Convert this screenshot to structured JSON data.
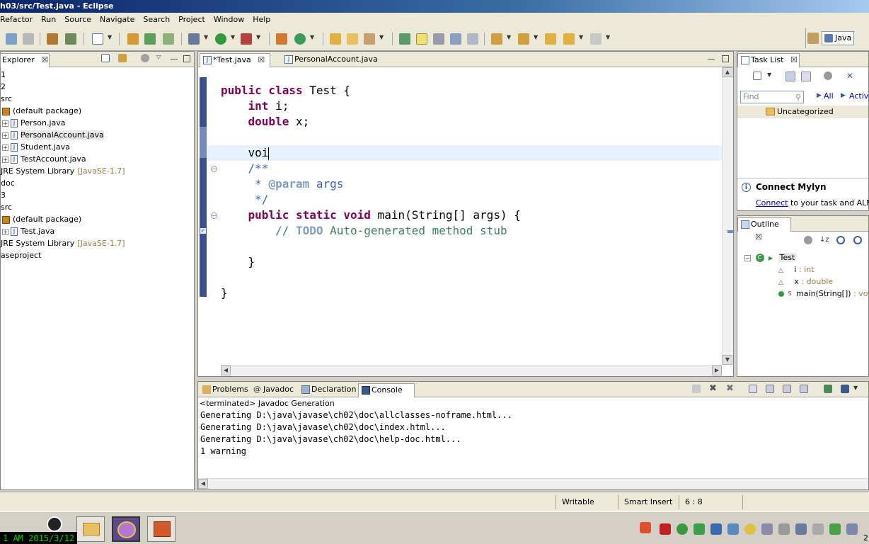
{
  "window": {
    "title": "h03/src/Test.java - Eclipse"
  },
  "menu": [
    "Refactor",
    "Run",
    "Source",
    "Navigate",
    "Search",
    "Project",
    "Window",
    "Help"
  ],
  "perspective": {
    "label": "Java"
  },
  "explorer": {
    "tab_label": "Explorer",
    "items": [
      {
        "text": "1",
        "indent": 0,
        "kind": "plain"
      },
      {
        "text": "2",
        "indent": 0,
        "kind": "plain"
      },
      {
        "text": "src",
        "indent": 0,
        "kind": "plain"
      },
      {
        "text": "(default package)",
        "indent": 1,
        "kind": "package"
      },
      {
        "text": "Person.java",
        "indent": 2,
        "kind": "java"
      },
      {
        "text": "PersonalAccount.java",
        "indent": 2,
        "kind": "java",
        "selected": true
      },
      {
        "text": "Student.java",
        "indent": 2,
        "kind": "java"
      },
      {
        "text": "TestAccount.java",
        "indent": 2,
        "kind": "java"
      },
      {
        "text": "JRE System Library",
        "suffix": "[JavaSE-1.7]",
        "indent": 0,
        "kind": "lib"
      },
      {
        "text": "doc",
        "indent": 0,
        "kind": "plain"
      },
      {
        "text": "3",
        "indent": 0,
        "kind": "plain"
      },
      {
        "text": "src",
        "indent": 0,
        "kind": "plain"
      },
      {
        "text": "(default package)",
        "indent": 1,
        "kind": "package"
      },
      {
        "text": "Test.java",
        "indent": 2,
        "kind": "java"
      },
      {
        "text": "JRE System Library",
        "suffix": "[JavaSE-1.7]",
        "indent": 0,
        "kind": "lib"
      },
      {
        "text": "aseproject",
        "indent": 0,
        "kind": "plain"
      }
    ]
  },
  "editor": {
    "tabs": [
      {
        "label": "*Test.java",
        "active": true
      },
      {
        "label": "PersonalAccount.java",
        "active": false
      }
    ],
    "lines": [
      {
        "indent": "",
        "tokens": [
          {
            "t": "public class",
            "c": "kw"
          },
          {
            "t": " Test {",
            "c": ""
          }
        ]
      },
      {
        "indent": "    ",
        "tokens": [
          {
            "t": "int",
            "c": "kw"
          },
          {
            "t": " i;",
            "c": ""
          }
        ]
      },
      {
        "indent": "    ",
        "tokens": [
          {
            "t": "double",
            "c": "kw"
          },
          {
            "t": " x;",
            "c": ""
          }
        ]
      },
      {
        "indent": "",
        "tokens": []
      },
      {
        "indent": "    ",
        "tokens": [
          {
            "t": "voi",
            "c": ""
          }
        ],
        "current": true,
        "caret": true
      },
      {
        "indent": "    ",
        "tokens": [
          {
            "t": "/**",
            "c": "cmt"
          }
        ]
      },
      {
        "indent": "     ",
        "tokens": [
          {
            "t": "* ",
            "c": "cmt"
          },
          {
            "t": "@param",
            "c": "tag"
          },
          {
            "t": " args",
            "c": "cmt"
          }
        ]
      },
      {
        "indent": "     ",
        "tokens": [
          {
            "t": "*/",
            "c": "cmt"
          }
        ]
      },
      {
        "indent": "    ",
        "tokens": [
          {
            "t": "public static void",
            "c": "kw"
          },
          {
            "t": " main(String[] args) {",
            "c": ""
          }
        ]
      },
      {
        "indent": "        ",
        "tokens": [
          {
            "t": "// ",
            "c": "lcmt"
          },
          {
            "t": "TODO",
            "c": "todo"
          },
          {
            "t": " Auto-generated method stub",
            "c": "lcmt"
          }
        ]
      },
      {
        "indent": "",
        "tokens": []
      },
      {
        "indent": "    ",
        "tokens": [
          {
            "t": "}",
            "c": ""
          }
        ]
      },
      {
        "indent": "",
        "tokens": []
      },
      {
        "indent": "",
        "tokens": [
          {
            "t": "}",
            "c": ""
          }
        ]
      }
    ]
  },
  "bottom": {
    "tabs": [
      {
        "label": "Problems",
        "active": false
      },
      {
        "label": "Javadoc",
        "active": false
      },
      {
        "label": "Declaration",
        "active": false
      },
      {
        "label": "Console",
        "active": true
      }
    ],
    "status": "<terminated> Javadoc Generation",
    "lines": [
      "Generating D:\\java\\javase\\ch02\\doc\\allclasses-noframe.html...",
      "Generating D:\\java\\javase\\ch02\\doc\\index.html...",
      "Generating D:\\java\\javase\\ch02\\doc\\help-doc.html...",
      "1 warning"
    ]
  },
  "tasklist": {
    "tab_label": "Task List",
    "find_placeholder": "Find",
    "all_label": "All",
    "activate_label": "Activa",
    "category": "Uncategorized",
    "mylyn_title": "Connect Mylyn",
    "mylyn_link": "Connect",
    "mylyn_text": " to your task and ALM to"
  },
  "outline": {
    "tab_label": "Outline",
    "class_name": "Test",
    "members": [
      {
        "name": "i",
        "type": ": int"
      },
      {
        "name": "x",
        "type": ": double"
      },
      {
        "name": "main(String[])",
        "type": ": void",
        "method": true
      }
    ]
  },
  "statusbar": {
    "writable": "Writable",
    "insert_mode": "Smart Insert",
    "position": "6 : 8"
  },
  "taskbar": {
    "clock": "1 AM 2015/3/12",
    "tray_tail": "2"
  },
  "colors": {
    "keyword": "#7f0055",
    "comment": "#3f5fbf",
    "line_comment": "#3f7f5f",
    "current_line": "#e8f2fe"
  }
}
